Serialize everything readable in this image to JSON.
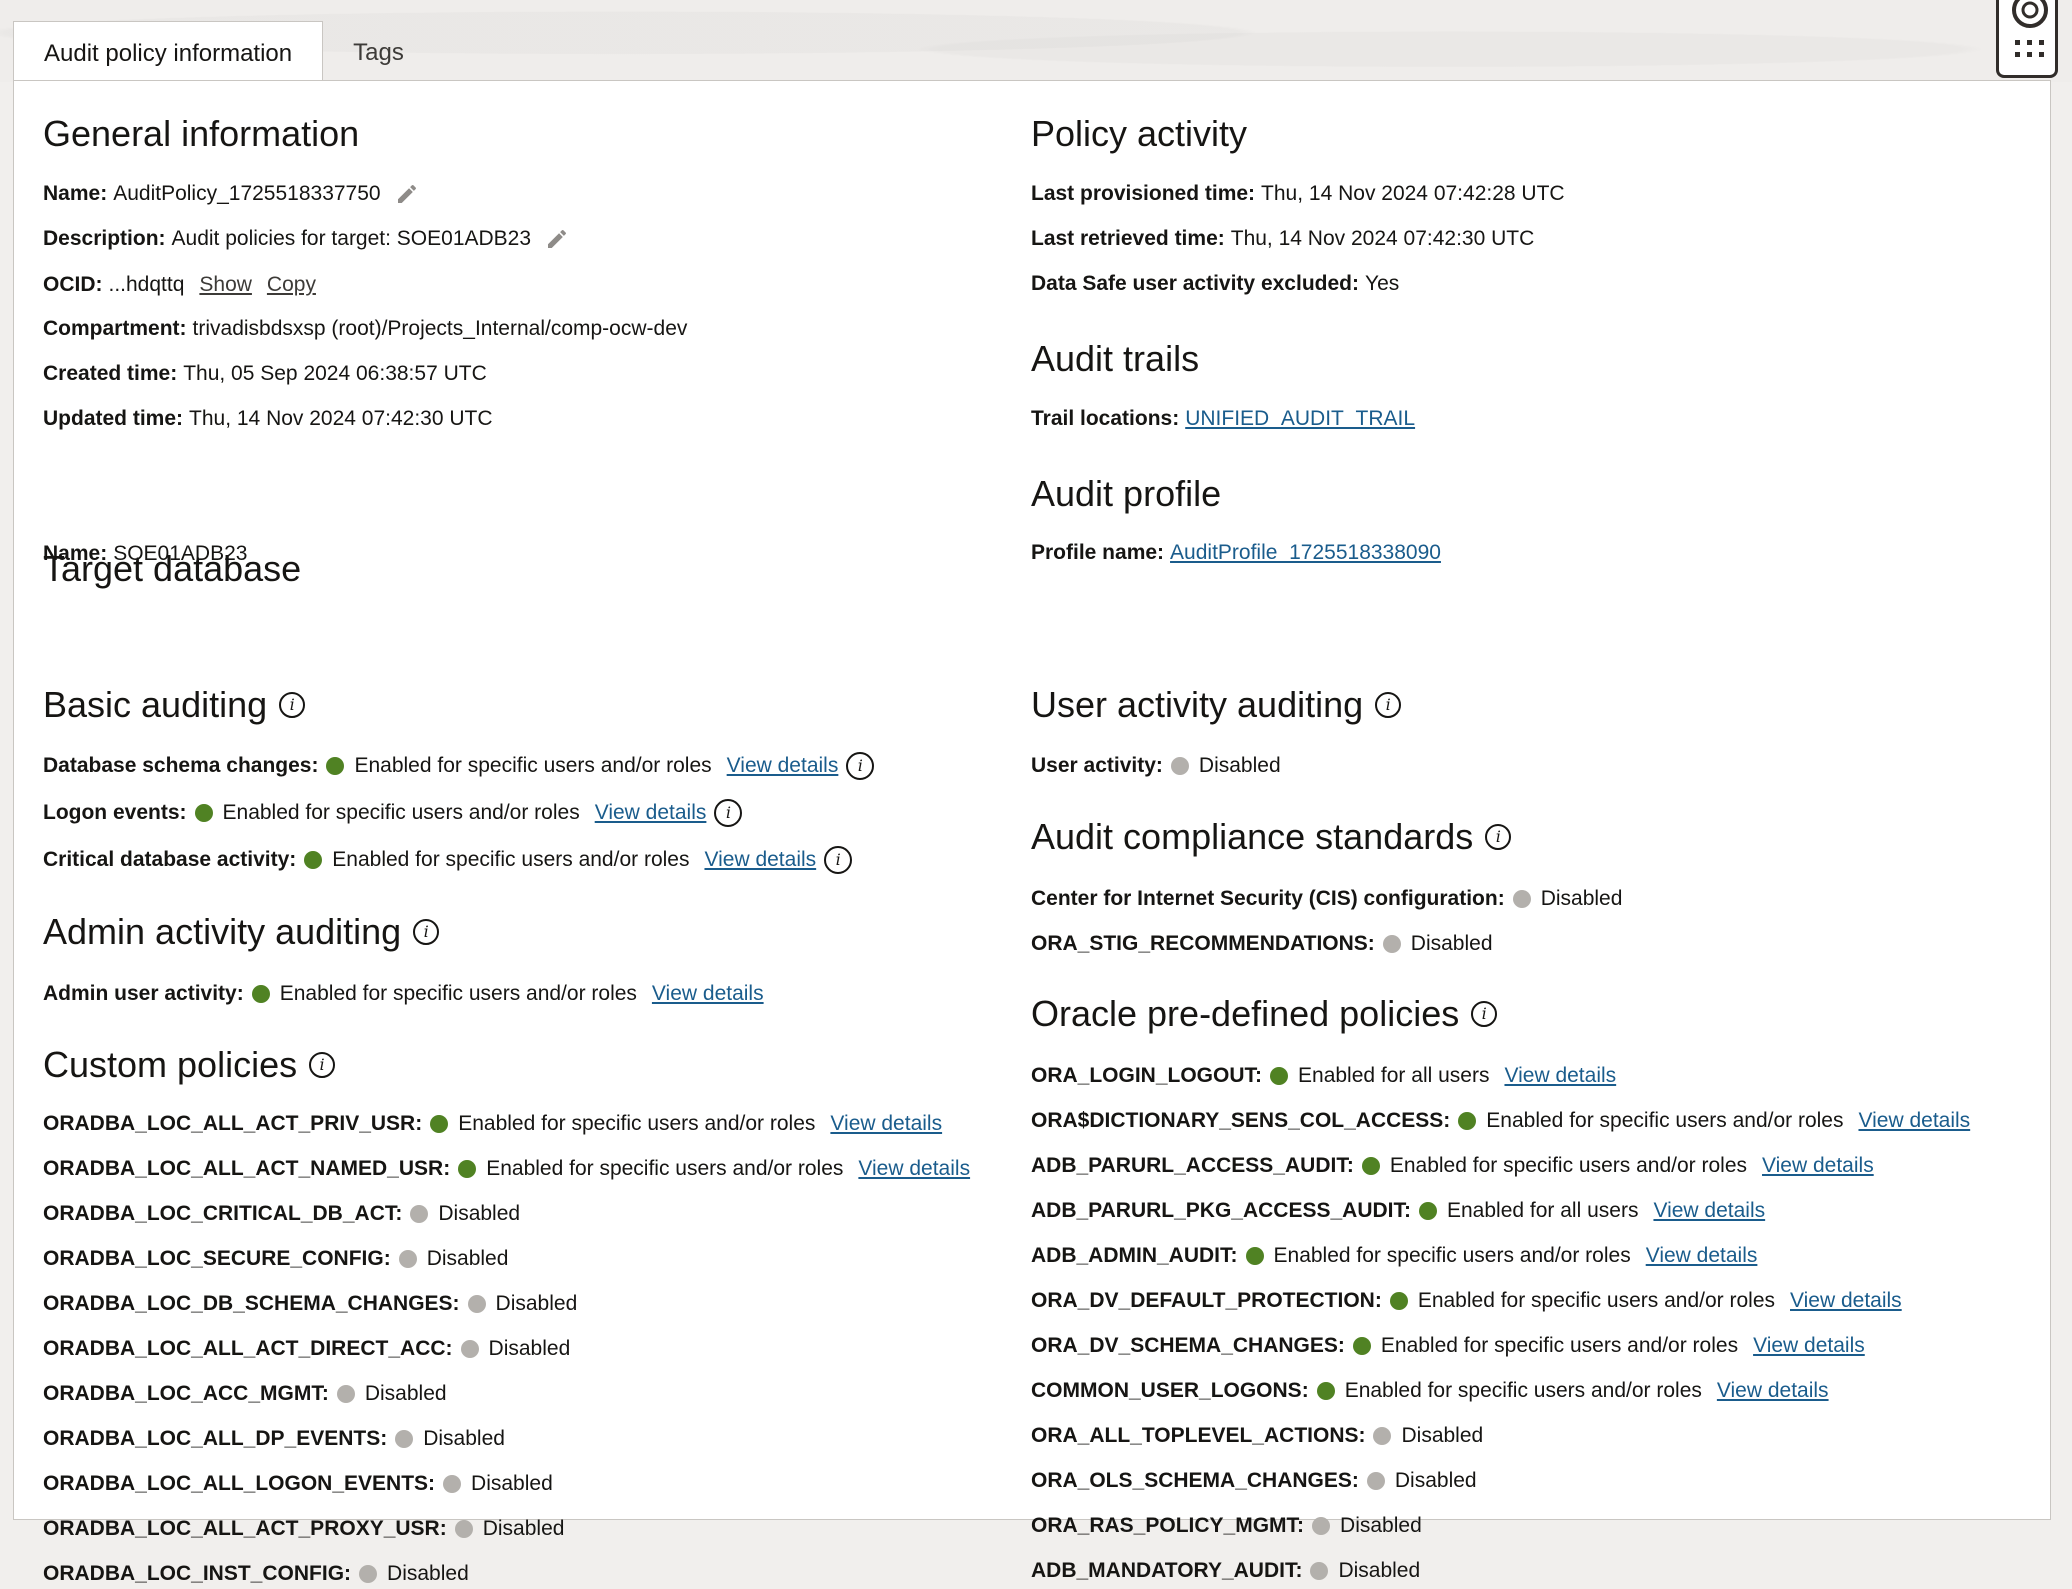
{
  "tabs": [
    {
      "label": "Audit policy information",
      "active": true
    },
    {
      "label": "Tags",
      "active": false
    }
  ],
  "general": {
    "title": "General information",
    "name_label": "Name:",
    "name_value": "AuditPolicy_1725518337750",
    "desc_label": "Description:",
    "desc_value": "Audit policies for target: SOE01ADB23",
    "ocid_label": "OCID:",
    "ocid_value": "...hdqttq",
    "ocid_show": "Show",
    "ocid_copy": "Copy",
    "compartment_label": "Compartment:",
    "compartment_value": "trivadisbdsxsp (root)/Projects_Internal/comp-ocw-dev",
    "created_label": "Created time:",
    "created_value": "Thu, 05 Sep 2024 06:38:57 UTC",
    "updated_label": "Updated time:",
    "updated_value": "Thu, 14 Nov 2024 07:42:30 UTC"
  },
  "target": {
    "title": "Target database",
    "name_label": "Name:",
    "name_value": "SOE01ADB23"
  },
  "basic": {
    "title": "Basic auditing",
    "items": [
      {
        "label": "Database schema changes:",
        "status": "Enabled for specific users and/or roles",
        "link": "View details"
      },
      {
        "label": "Logon events:",
        "status": "Enabled for specific users and/or roles",
        "link": "View details"
      },
      {
        "label": "Critical database activity:",
        "status": "Enabled for specific users and/or roles",
        "link": "View details"
      }
    ]
  },
  "admin": {
    "title": "Admin activity auditing",
    "label": "Admin user activity:",
    "status": "Enabled for specific users and/or roles",
    "link": "View details"
  },
  "custom": {
    "title": "Custom policies",
    "items": [
      {
        "label": "ORADBA_LOC_ALL_ACT_PRIV_USR:",
        "status": "Enabled for specific users and/or roles",
        "link": "View details"
      },
      {
        "label": "ORADBA_LOC_ALL_ACT_NAMED_USR:",
        "status": "Enabled for specific users and/or roles",
        "link": "View details"
      },
      {
        "label": "ORADBA_LOC_CRITICAL_DB_ACT:",
        "status": "Disabled"
      },
      {
        "label": "ORADBA_LOC_SECURE_CONFIG:",
        "status": "Disabled"
      },
      {
        "label": "ORADBA_LOC_DB_SCHEMA_CHANGES:",
        "status": "Disabled"
      },
      {
        "label": "ORADBA_LOC_ALL_ACT_DIRECT_ACC:",
        "status": "Disabled"
      },
      {
        "label": "ORADBA_LOC_ACC_MGMT:",
        "status": "Disabled"
      },
      {
        "label": "ORADBA_LOC_ALL_DP_EVENTS:",
        "status": "Disabled"
      },
      {
        "label": "ORADBA_LOC_ALL_LOGON_EVENTS:",
        "status": "Disabled"
      },
      {
        "label": "ORADBA_LOC_ALL_ACT_PROXY_USR:",
        "status": "Disabled"
      },
      {
        "label": "ORADBA_LOC_INST_CONFIG:",
        "status": "Disabled"
      }
    ]
  },
  "activity": {
    "title": "Policy activity",
    "prov_label": "Last provisioned time:",
    "prov_value": "Thu, 14 Nov 2024 07:42:28 UTC",
    "retr_label": "Last retrieved time:",
    "retr_value": "Thu, 14 Nov 2024 07:42:30 UTC",
    "excl_label": "Data Safe user activity excluded:",
    "excl_value": "Yes"
  },
  "trails": {
    "title": "Audit trails",
    "label": "Trail locations:",
    "link": "UNIFIED_AUDIT_TRAIL"
  },
  "profile": {
    "title": "Audit profile",
    "label": "Profile name:",
    "link": "AuditProfile_1725518338090"
  },
  "user_activity": {
    "title": "User activity auditing",
    "label": "User activity:",
    "status": "Disabled"
  },
  "compliance": {
    "title": "Audit compliance standards",
    "items": [
      {
        "label": "Center for Internet Security (CIS) configuration:",
        "status": "Disabled"
      },
      {
        "label": "ORA_STIG_RECOMMENDATIONS:",
        "status": "Disabled"
      }
    ]
  },
  "predefined": {
    "title": "Oracle pre-defined policies",
    "items": [
      {
        "label": "ORA_LOGIN_LOGOUT:",
        "status": "Enabled for all users",
        "link": "View details"
      },
      {
        "label": "ORA$DICTIONARY_SENS_COL_ACCESS:",
        "status": "Enabled for specific users and/or roles",
        "link": "View details"
      },
      {
        "label": "ADB_PARURL_ACCESS_AUDIT:",
        "status": "Enabled for specific users and/or roles",
        "link": "View details"
      },
      {
        "label": "ADB_PARURL_PKG_ACCESS_AUDIT:",
        "status": "Enabled for all users",
        "link": "View details"
      },
      {
        "label": "ADB_ADMIN_AUDIT:",
        "status": "Enabled for specific users and/or roles",
        "link": "View details"
      },
      {
        "label": "ORA_DV_DEFAULT_PROTECTION:",
        "status": "Enabled for specific users and/or roles",
        "link": "View details"
      },
      {
        "label": "ORA_DV_SCHEMA_CHANGES:",
        "status": "Enabled for specific users and/or roles",
        "link": "View details"
      },
      {
        "label": "COMMON_USER_LOGONS:",
        "status": "Enabled for specific users and/or roles",
        "link": "View details"
      },
      {
        "label": "ORA_ALL_TOPLEVEL_ACTIONS:",
        "status": "Disabled"
      },
      {
        "label": "ORA_OLS_SCHEMA_CHANGES:",
        "status": "Disabled"
      },
      {
        "label": "ORA_RAS_POLICY_MGMT:",
        "status": "Disabled"
      },
      {
        "label": "ADB_MANDATORY_AUDIT:",
        "status": "Disabled"
      }
    ]
  },
  "status_colors": {
    "enabled": "#508223",
    "disabled": "#b3b0ac",
    "link": "#1a5c8c"
  },
  "icons": {
    "info": "info-icon",
    "edit": "pencil-icon",
    "help": "help-lifebuoy-icon",
    "apps": "app-grid-icon"
  }
}
